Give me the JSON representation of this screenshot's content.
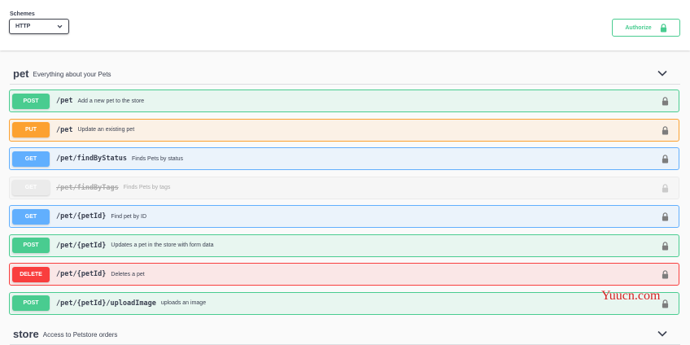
{
  "topbar": {
    "schemes_label": "Schemes",
    "schemes_value": "HTTP",
    "authorize_label": "Authorize"
  },
  "tags": [
    {
      "name": "pet",
      "description": "Everything about your Pets",
      "expanded": true,
      "operations": [
        {
          "method": "POST",
          "path": "/pet",
          "summary": "Add a new pet to the store",
          "color": "#49cc90",
          "bg": "#e8f6f0",
          "deprecated": false
        },
        {
          "method": "PUT",
          "path": "/pet",
          "summary": "Update an existing pet",
          "color": "#fca130",
          "bg": "#fbf1e6",
          "deprecated": false
        },
        {
          "method": "GET",
          "path": "/pet/findByStatus",
          "summary": "Finds Pets by status",
          "color": "#61affe",
          "bg": "#ebf3fb",
          "deprecated": false
        },
        {
          "method": "GET",
          "path": "/pet/findByTags",
          "summary": "Finds Pets by tags",
          "color": "#ebebeb",
          "bg": "#f6f6f6",
          "deprecated": true
        },
        {
          "method": "GET",
          "path": "/pet/{petId}",
          "summary": "Find pet by ID",
          "color": "#61affe",
          "bg": "#ebf3fb",
          "deprecated": false
        },
        {
          "method": "POST",
          "path": "/pet/{petId}",
          "summary": "Updates a pet in the store with form data",
          "color": "#49cc90",
          "bg": "#e8f6f0",
          "deprecated": false
        },
        {
          "method": "DELETE",
          "path": "/pet/{petId}",
          "summary": "Deletes a pet",
          "color": "#f93e3e",
          "bg": "#fae7e7",
          "deprecated": false
        },
        {
          "method": "POST",
          "path": "/pet/{petId}/uploadImage",
          "summary": "uploads an image",
          "color": "#49cc90",
          "bg": "#e8f6f0",
          "deprecated": false
        }
      ]
    },
    {
      "name": "store",
      "description": "Access to Petstore orders",
      "expanded": false,
      "operations": []
    }
  ],
  "watermark": "Yuucn.com",
  "icons": {
    "select_chevron": "chevron-down-icon",
    "authorize_lock": "lock-icon",
    "tag_toggle": "chevron-down-icon",
    "operation_lock": "lock-icon"
  },
  "colors": {
    "accent_green": "#49cc90",
    "text": "#3b4151"
  }
}
